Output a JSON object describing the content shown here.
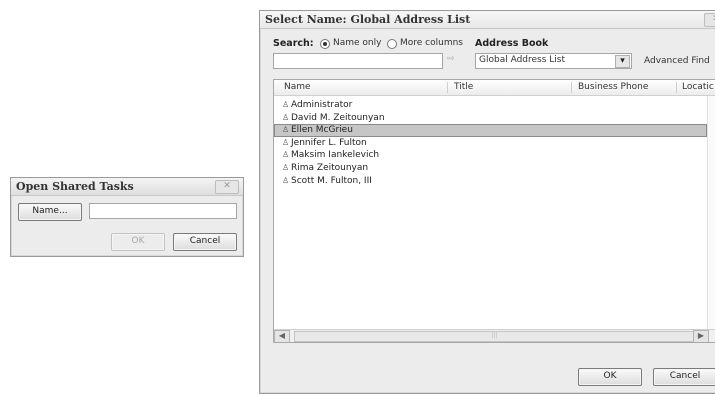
{
  "open_shared_tasks": {
    "title": "Open Shared Tasks",
    "close_glyph": "✕",
    "name_button": "Name...",
    "name_value": "",
    "ok_button": "OK",
    "cancel_button": "Cancel"
  },
  "select_name": {
    "title": "Select Name: Global Address List",
    "search_label": "Search:",
    "radio_name_only": "Name only",
    "radio_more_columns": "More columns",
    "search_value": "",
    "go_glyph": "⇨",
    "address_book_label": "Address Book",
    "address_book_value": "Global Address List",
    "dropdown_glyph": "▾",
    "advanced_find": "Advanced Find",
    "columns": [
      "Name",
      "Title",
      "Business Phone",
      "Locatic"
    ],
    "contacts": [
      "Administrator",
      "David M. Zeitounyan",
      "Ellen McGrieu",
      "Jennifer L. Fulton",
      "Maksim Iankelevich",
      "Rima Zeitounyan",
      "Scott M. Fulton, III"
    ],
    "selected_index": 2,
    "scroll_left": "◀",
    "scroll_right": "▶",
    "ok_button": "OK",
    "cancel_button": "Cancel"
  }
}
